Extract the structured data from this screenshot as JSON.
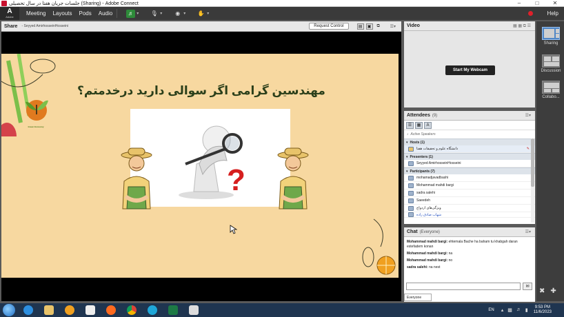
{
  "window": {
    "title": "جلسات جریان هفتا در سال تحصیلی (Sharing) - Adobe Connect"
  },
  "menubar": {
    "items": [
      "Meeting",
      "Layouts",
      "Pods",
      "Audio"
    ],
    "help": "Help"
  },
  "share_pod": {
    "title": "Share",
    "presenter": "- Seyyed AmirhosseinHosseini",
    "request_control": "Request Control"
  },
  "slide": {
    "heading": "مهندسین گرامی اگر سوالی دارید درخدمتم؟",
    "logo_text": "Green Economy"
  },
  "video_pod": {
    "title": "Video",
    "webcam_button": "Start My Webcam"
  },
  "attendees_pod": {
    "title": "Attendees",
    "count": "(9)",
    "active_speakers": "Active Speakers",
    "hosts_header": "Hosts (1)",
    "hosts": [
      "دانشگاه علوم و تحقیقات هفتا"
    ],
    "presenters_header": "Presenters (1)",
    "presenters": [
      "Seyyed AmirhosseinHosseini"
    ],
    "participants_header": "Participants (7)",
    "participants": [
      "mohamadjavadbashi",
      "Mohammad mahdi bargi",
      "sadra salehi",
      "Saeedeh",
      "ویژگی‌های ازدواج",
      "شهاب صادق زاده"
    ]
  },
  "chat_pod": {
    "title": "Chat",
    "scope": "(Everyone)",
    "messages": [
      {
        "sender": "Mohammad mahdi bargi:",
        "text": "ehtemala Bache ha baham tu khabgah daran estefadem konan"
      },
      {
        "sender": "Mohammad mahdi bargi:",
        "text": "na"
      },
      {
        "sender": "Mohammad mahdi bargi:",
        "text": "no"
      },
      {
        "sender": "sadra salehi:",
        "text": "na nest"
      }
    ],
    "tab": "Everyone"
  },
  "layouts_rail": {
    "items": [
      "Sharing",
      "Discussion",
      "Collabo..."
    ]
  },
  "taskbar": {
    "lang": "EN",
    "time": "9:53 PM",
    "date": "11/6/2023"
  },
  "colors": {
    "slide_background": "#f7d8a0",
    "heading": "#2b3f1a",
    "accent_selected_layout": "#4f86c6",
    "record": "#e0202a"
  }
}
